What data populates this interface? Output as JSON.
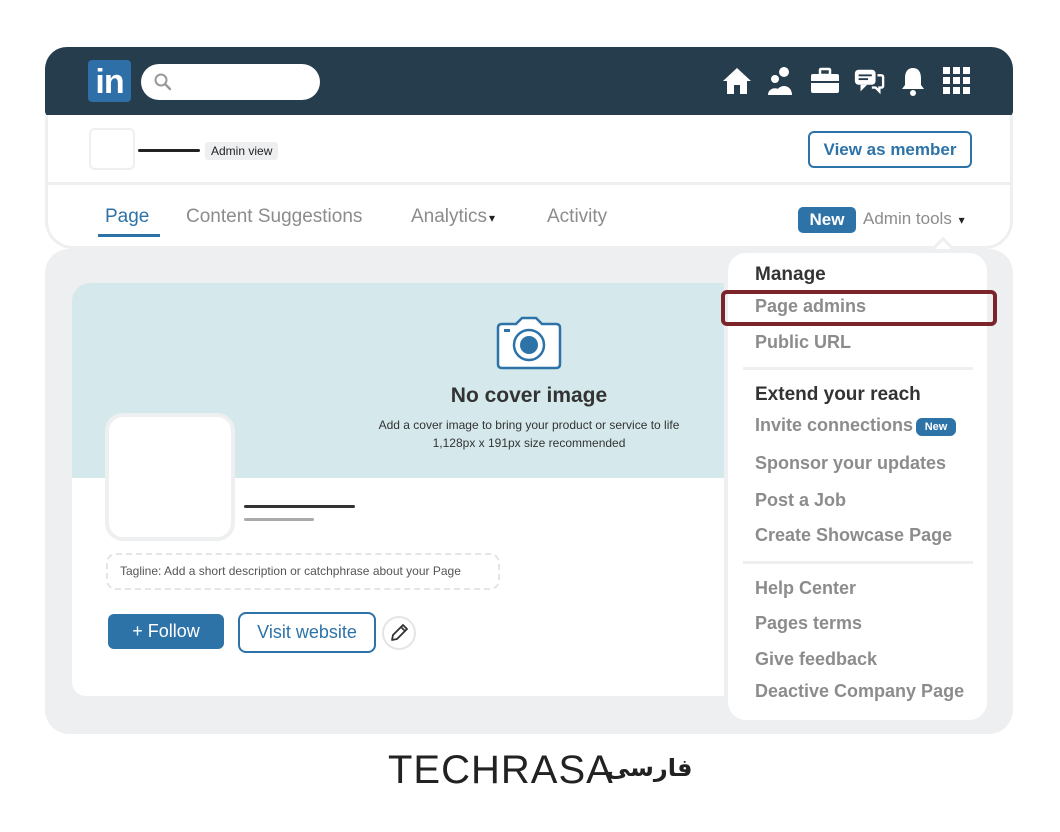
{
  "topbar": {
    "logo_text": "in",
    "search": {
      "placeholder": ""
    },
    "nav_icons": [
      "home-icon",
      "people-icon",
      "briefcase-icon",
      "messaging-icon",
      "bell-icon",
      "grid-icon"
    ]
  },
  "header": {
    "admin_view_label": "Admin view",
    "view_as_member_label": "View as member",
    "tabs": [
      {
        "label": "Page",
        "active": true
      },
      {
        "label": "Content Suggestions",
        "active": false
      },
      {
        "label": "Analytics",
        "active": false,
        "caret": "▾"
      },
      {
        "label": "Activity",
        "active": false
      }
    ],
    "new_badge": "New",
    "admin_tools_label": "Admin tools",
    "admin_tools_caret": "▾"
  },
  "cover": {
    "title": "No cover image",
    "subtitle": "Add a cover image to bring your product or service to life",
    "size_note": "1,128px x 191px size recommended"
  },
  "profile": {
    "tagline_placeholder": "Tagline: Add a short description or catchphrase about your Page",
    "follow_label": "+ Follow",
    "visit_label": "Visit website"
  },
  "dropdown": {
    "manage_heading": "Manage",
    "manage_items": [
      "Page admins",
      "Public URL"
    ],
    "extend_heading": "Extend your reach",
    "extend_items": [
      "Invite connections",
      "Sponsor your updates",
      "Post a Job",
      "Create Showcase Page"
    ],
    "new_tag": "New",
    "help_items": [
      "Help Center",
      "Pages terms",
      "Give feedback",
      "Deactive Company Page"
    ],
    "highlighted_item": "Page admins"
  },
  "footer": {
    "brand": "TECHRASA",
    "brand_fa": "فارسی"
  },
  "colors": {
    "navbar": "#263d4d",
    "accent": "#2d73a8",
    "cover": "#d5e9ec",
    "highlight": "#7b2429"
  }
}
